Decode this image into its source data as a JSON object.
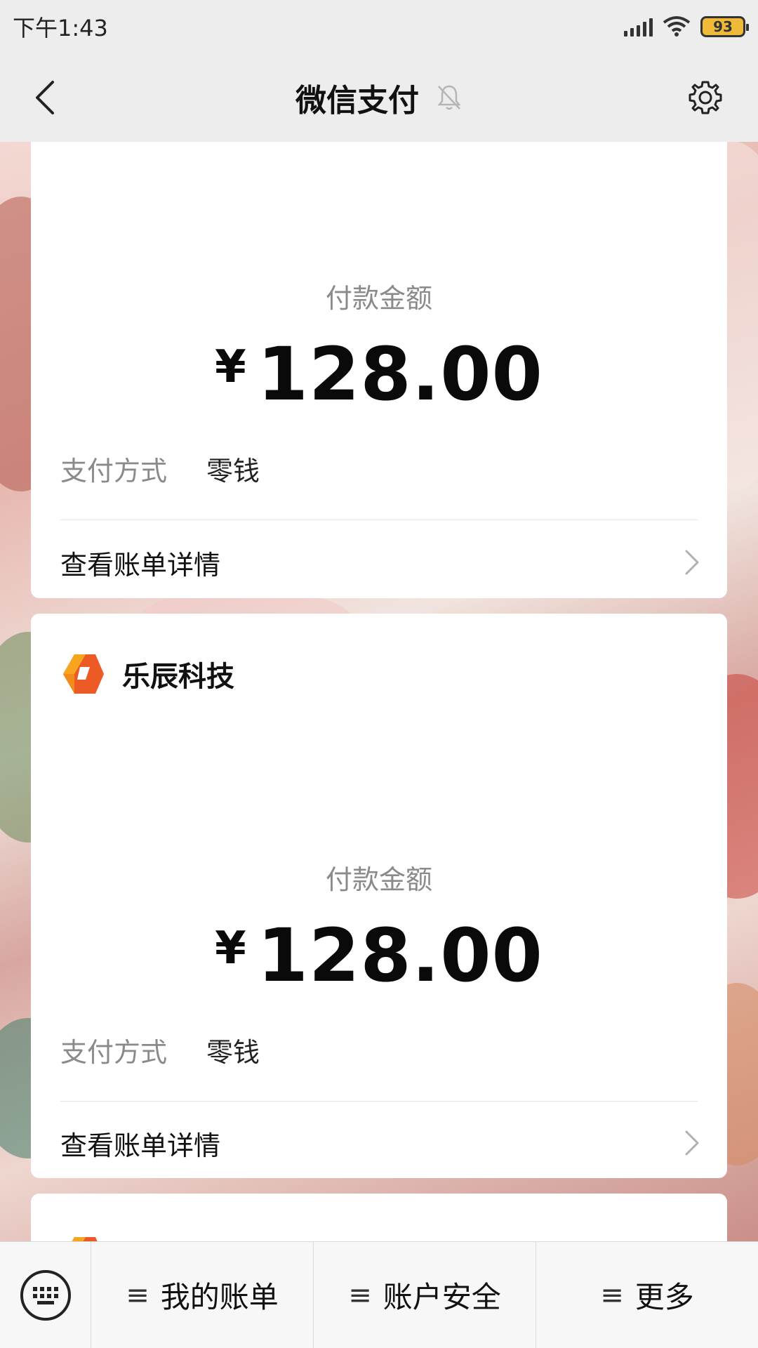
{
  "status_bar": {
    "time": "下午1:43",
    "battery": "93"
  },
  "header": {
    "title": "微信支付"
  },
  "cards": [
    {
      "amount_label": "付款金额",
      "currency": "¥",
      "amount": "128.00",
      "pay_method_key": "支付方式",
      "pay_method_value": "零钱",
      "detail_label": "查看账单详情"
    },
    {
      "merchant": "乐辰科技",
      "amount_label": "付款金额",
      "currency": "¥",
      "amount": "128.00",
      "pay_method_key": "支付方式",
      "pay_method_value": "零钱",
      "detail_label": "查看账单详情"
    }
  ],
  "bottom_menu": [
    {
      "label": "我的账单"
    },
    {
      "label": "账户安全"
    },
    {
      "label": "更多"
    }
  ]
}
